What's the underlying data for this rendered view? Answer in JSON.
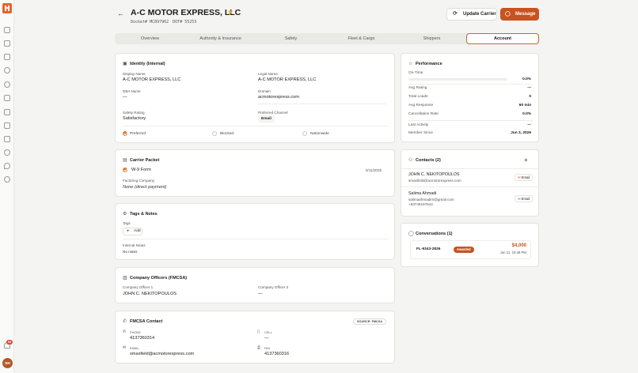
{
  "colors": {
    "accent": "#c8531f",
    "star": "#e0a82a",
    "badge": "#e0473a"
  },
  "sidebar": {
    "icons": [
      "home-icon",
      "chat-icon",
      "truck-icon",
      "phone-icon",
      "globe-icon",
      "building-icon",
      "shipment-icon",
      "document-icon",
      "invoice-icon",
      "message-icon",
      "location-icon",
      "users-icon"
    ],
    "notifications": "99",
    "avatar_initials": "NH"
  },
  "header": {
    "title": "A-C MOTOR EXPRESS, LLC",
    "docket": "Docket# MC897962",
    "dot": "DOT# 55253",
    "update_label": "Update Carrier",
    "message_label": "Message"
  },
  "tabs": [
    "Overview",
    "Authority & Insurance",
    "Safety",
    "Fleet & Cargo",
    "Shippers",
    "Account"
  ],
  "active_tab": "Account",
  "identity": {
    "title": "Identity (Internal)",
    "display_name_label": "Display Name",
    "display_name": "A-C MOTOR EXPRESS, LLC",
    "legal_name_label": "Legal Name",
    "legal_name": "A-C MOTOR EXPRESS, LLC",
    "dba_label": "DBA Name",
    "dba": "—",
    "domain_label": "Domain",
    "domain": "acmotorexpress.com",
    "safety_label": "Safety Rating",
    "safety": "Satisfactory",
    "channel_label": "Preferred Channel",
    "channel": "Email",
    "flags": [
      {
        "label": "Preferred",
        "on": true
      },
      {
        "label": "Blocked",
        "on": false
      },
      {
        "label": "Nationwide",
        "on": false
      }
    ]
  },
  "packet": {
    "title": "Carrier Packet",
    "w9_label": "W-9 Form",
    "w9_date": "6/11/2026",
    "factoring_label": "Factoring Company",
    "factoring": "None (direct payment)"
  },
  "tags": {
    "title": "Tags & Notes",
    "tags_label": "Tags",
    "add_label": "Add",
    "notes_label": "Internal Notes",
    "notes": "No notes"
  },
  "officers": {
    "title": "Company Officers (FMCSA)",
    "o1_label": "Company Officer 1",
    "o1": "JOHN C. NEKITOPOULOS",
    "o2_label": "Company Officer 2",
    "o2": "—"
  },
  "fmcsa": {
    "title": "FMCSA Contact",
    "source": "SOURCE: FMCSA",
    "phone_label": "PHONE",
    "phone": "4137360314",
    "cell_label": "CELL",
    "cell": "—",
    "email_label": "EMAIL",
    "email": "smaxfield@acmotorexpress.com",
    "fax_label": "FAX",
    "fax": "4137360316"
  },
  "performance": {
    "title": "Performance",
    "ontime_label": "On-Time",
    "ontime": "0.0%",
    "ontime_fraction": 0,
    "rows": [
      {
        "label": "Avg Rating",
        "value": "—"
      },
      {
        "label": "Total Loads",
        "value": "0"
      },
      {
        "label": "Avg Response",
        "value": "60 min"
      },
      {
        "label": "Cancellation Rate",
        "value": "0.0%"
      }
    ],
    "rows2": [
      {
        "label": "Last Activity",
        "value": "—"
      },
      {
        "label": "Member Since",
        "value": "Jun 3, 2026"
      }
    ]
  },
  "contacts": {
    "title": "Contacts (2)",
    "email_label": "Email",
    "list": [
      {
        "name": "JOHN C. NEKITOPOULOS",
        "email": "smaxfield@acmotorexpress.com",
        "phone": ""
      },
      {
        "name": "Salima Ahmadi",
        "email": "salimaahmadim@gmail.com",
        "phone": "+93748197644"
      }
    ]
  },
  "conversations": {
    "title": "Conversations (1)",
    "items": [
      {
        "id": "FL-9343-2836",
        "status": "Awarded",
        "amount": "$4,000",
        "date": "Jun 11, 10:48 PM"
      }
    ]
  }
}
